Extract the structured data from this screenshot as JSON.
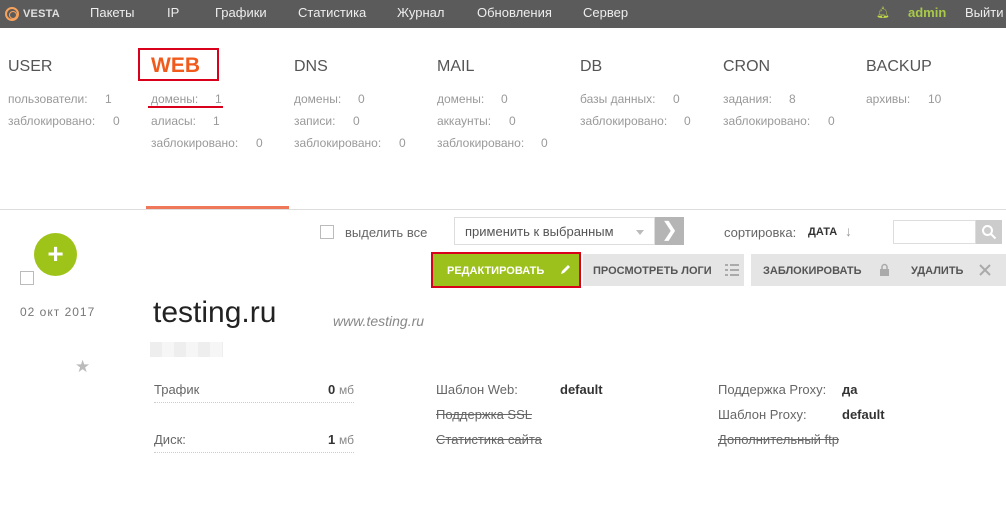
{
  "brand": "VESTA",
  "nav": [
    "Пакеты",
    "IP",
    "Графики",
    "Статистика",
    "Журнал",
    "Обновления",
    "Сервер"
  ],
  "user": "admin",
  "exit": "Выйти",
  "panels": {
    "user": {
      "title": "USER",
      "stats": [
        [
          "пользователи:",
          "1"
        ],
        [
          "заблокировано:",
          "0"
        ]
      ]
    },
    "web": {
      "title": "WEB",
      "stats": [
        [
          "домены:",
          "1"
        ],
        [
          "алиасы:",
          "1"
        ],
        [
          "заблокировано:",
          "0"
        ]
      ]
    },
    "dns": {
      "title": "DNS",
      "stats": [
        [
          "домены:",
          "0"
        ],
        [
          "записи:",
          "0"
        ],
        [
          "заблокировано:",
          "0"
        ]
      ]
    },
    "mail": {
      "title": "MAIL",
      "stats": [
        [
          "домены:",
          "0"
        ],
        [
          "аккаунты:",
          "0"
        ],
        [
          "заблокировано:",
          "0"
        ]
      ]
    },
    "db": {
      "title": "DB",
      "stats": [
        [
          "базы данных:",
          "0"
        ],
        [
          "заблокировано:",
          "0"
        ]
      ]
    },
    "cron": {
      "title": "CRON",
      "stats": [
        [
          "задания:",
          "8"
        ],
        [
          "заблокировано:",
          "0"
        ]
      ]
    },
    "backup": {
      "title": "BACKUP",
      "stats": [
        [
          "архивы:",
          "10"
        ]
      ]
    }
  },
  "toolbar": {
    "select_all": "выделить все",
    "apply": "применить к выбранным",
    "sort_label": "сортировка:",
    "sort_value": "ДАТА",
    "sort_arrow": "↓"
  },
  "actions": {
    "edit": "РЕДАКТИРОВАТЬ",
    "logs": "ПРОСМОТРЕТЬ ЛОГИ",
    "block": "ЗАБЛОКИРОВАТЬ",
    "delete": "УДАЛИТЬ"
  },
  "record": {
    "date": "02  окт  2017",
    "domain": "testing.ru",
    "alias": "www.testing.ru",
    "traffic_label": "Трафик",
    "traffic_value": "0",
    "traffic_unit": "мб",
    "disk_label": "Диск:",
    "disk_value": "1",
    "disk_unit": "мб",
    "web_template_label": "Шаблон Web:",
    "web_template_value": "default",
    "ssl_label": "Поддержка SSL",
    "stats_label": "Статистика сайта",
    "proxy_support_label": "Поддержка Proxy:",
    "proxy_support_value": "да",
    "proxy_template_label": "Шаблон Proxy:",
    "proxy_template_value": "default",
    "ftp_label": "Дополнительный ftp"
  }
}
